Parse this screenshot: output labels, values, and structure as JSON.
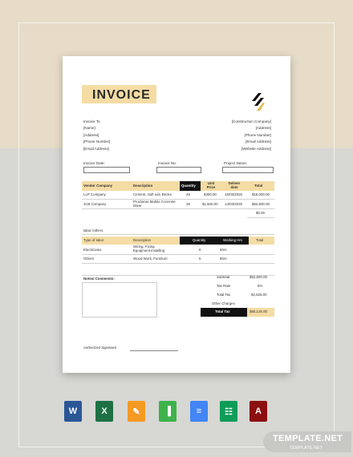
{
  "colors": {
    "accent": "#f4dca4",
    "dark": "#111111",
    "background_top": "#e6dcc8",
    "background_bottom": "#d7d7d4"
  },
  "invoice": {
    "title": "INVOICE",
    "bill_to": [
      "Invoice To",
      "[Name]",
      "[Address]",
      "[Phone Number]",
      "[Email Address]"
    ],
    "company": [
      "[Construction Company]",
      "[Address]",
      "[Phone Number]",
      "[Email Address]",
      "[Website Address]"
    ],
    "fields": {
      "invoice_date": "Invoice Date:",
      "invoice_no": "Invoice No:",
      "project_name": "Project Name:"
    },
    "vendors": {
      "headers": [
        "Vendor Company",
        "Description",
        "Quantity",
        "Unit Price",
        "Deliver date",
        "Total"
      ],
      "rows": [
        [
          "LLP Company",
          "Cement, Soft soil, Bricks",
          "45",
          "$400.00",
          "16/03/2025",
          "$18,000.00"
        ],
        [
          "JCB Company",
          "Proclainer,Mobile Concrete Mixer",
          "35",
          "$1,500.00",
          "14/03/2025",
          "$52,500.00"
        ]
      ],
      "subtotal": "$0.00"
    },
    "labor": {
      "section_title": "labor /others",
      "headers": [
        "Type of labor",
        "Description",
        "Quantity",
        "Working Hrs",
        "Total"
      ],
      "rows": [
        [
          "Electricians",
          "Wiring, Fixing Equipment,installing",
          "6",
          "5hrs",
          ""
        ],
        [
          "Others",
          "Wood Work, Furniture",
          "5",
          "8hrs",
          ""
        ]
      ]
    },
    "notes_label": "Notes/ Comments:",
    "summary": {
      "subtotal_label": "Subtotal",
      "subtotal": "$52,500.00",
      "tax_rate_label": "Tax Rate",
      "tax_rate": "5%",
      "total_tax_label": "Total Tax",
      "total_tax": "$2,625.00",
      "other_label": "Other Charges",
      "other": "",
      "grand_label": "Total Tax",
      "grand": "$55,125.00"
    },
    "signature_label": "Authorized Signature:"
  },
  "format_icons": [
    {
      "name": "word-icon",
      "letter": "W",
      "color": "#2b5797"
    },
    {
      "name": "excel-icon",
      "letter": "X",
      "color": "#1e7145"
    },
    {
      "name": "pages-icon",
      "letter": "✎",
      "color": "#f59a23"
    },
    {
      "name": "numbers-icon",
      "letter": "▐",
      "color": "#3db34a"
    },
    {
      "name": "google-docs-icon",
      "letter": "≡",
      "color": "#4285f4"
    },
    {
      "name": "google-sheets-icon",
      "letter": "☷",
      "color": "#0f9d58"
    },
    {
      "name": "pdf-icon",
      "letter": "A",
      "color": "#8b1010"
    }
  ],
  "brand": {
    "name": "TEMPLATE.NET",
    "watermark": "TEMPLATE.NET"
  }
}
